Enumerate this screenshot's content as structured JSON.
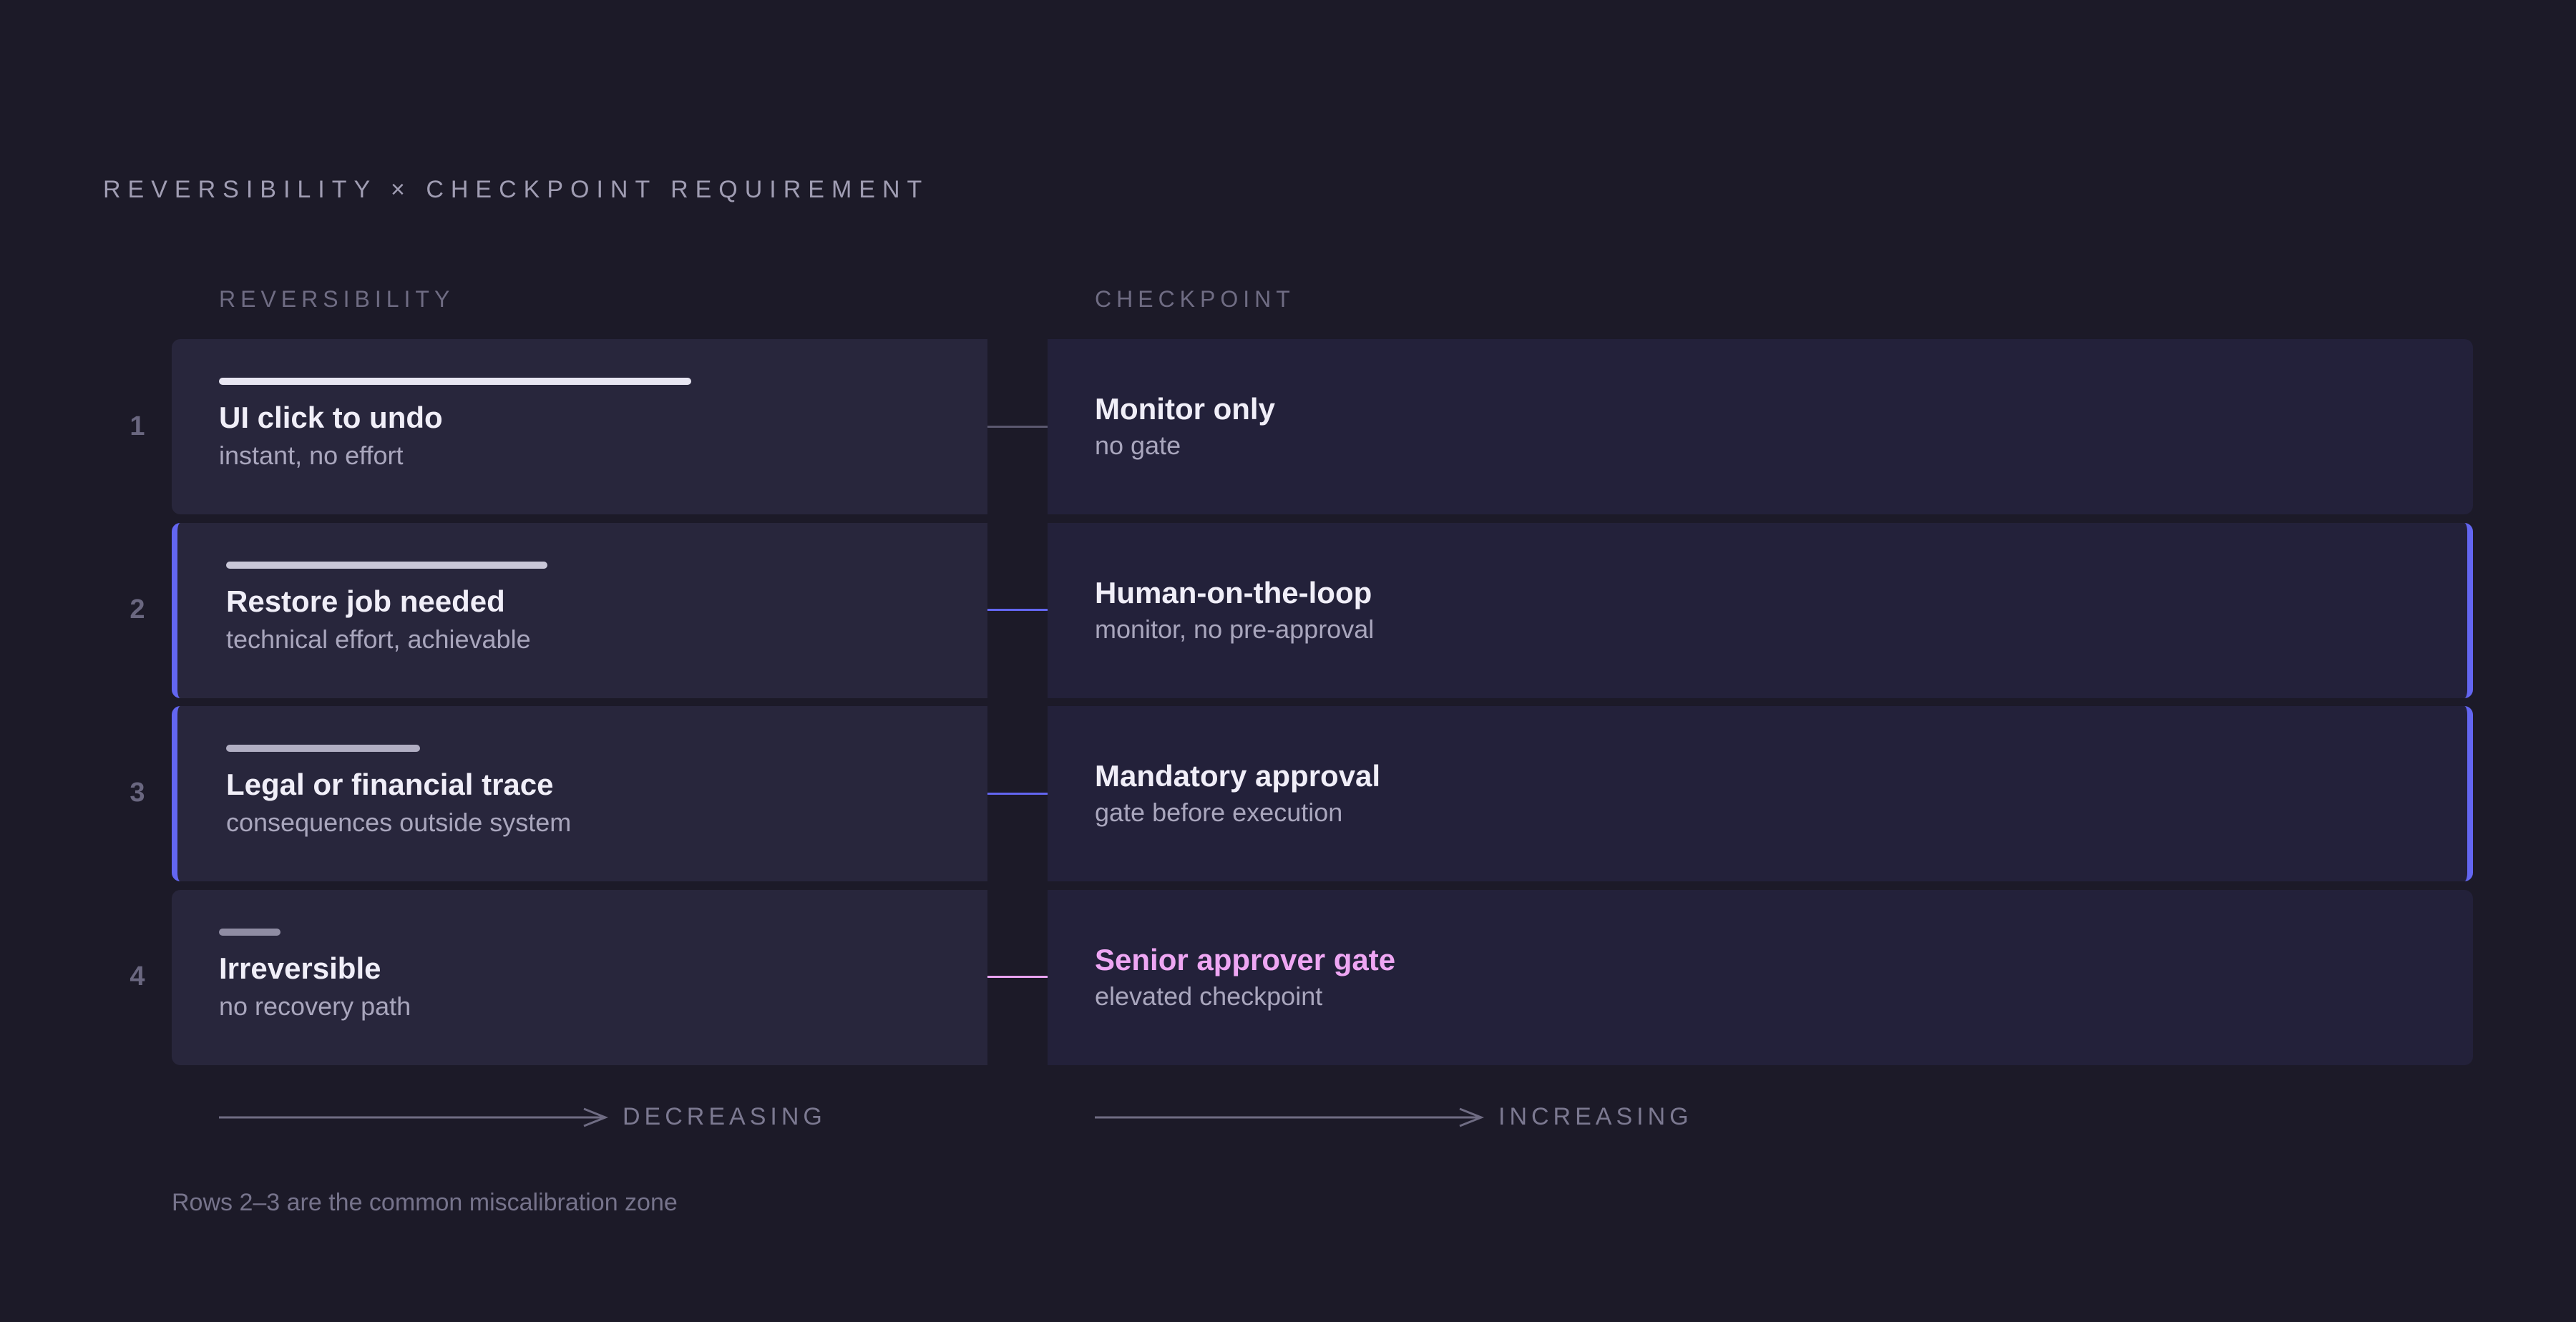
{
  "title": "REVERSIBILITY × CHECKPOINT REQUIREMENT",
  "columns": {
    "left": "REVERSIBILITY",
    "right": "CHECKPOINT"
  },
  "rows": [
    {
      "num": "1",
      "rev_title": "UI click to undo",
      "rev_sub": "instant, no effort",
      "rev_level": 1.0,
      "chk_title": "Monitor only",
      "chk_sub": "no gate",
      "highlight": false,
      "connector_color": "#5b586f",
      "bar_color": "#e8e6f2",
      "chk_title_color": "#f0eef8"
    },
    {
      "num": "2",
      "rev_title": "Restore job needed",
      "rev_sub": "technical effort, achievable",
      "rev_level": 0.68,
      "chk_title": "Human-on-the-loop",
      "chk_sub": "monitor, no pre-approval",
      "highlight": true,
      "connector_color": "#6366f1",
      "bar_color": "#c9c7d8",
      "chk_title_color": "#f0eef8"
    },
    {
      "num": "3",
      "rev_title": "Legal or financial trace",
      "rev_sub": "consequences outside system",
      "rev_level": 0.41,
      "chk_title": "Mandatory approval",
      "chk_sub": "gate before execution",
      "highlight": true,
      "connector_color": "#6366f1",
      "bar_color": "#b1aec3",
      "chk_title_color": "#f0eef8"
    },
    {
      "num": "4",
      "rev_title": "Irreversible",
      "rev_sub": "no recovery path",
      "rev_level": 0.13,
      "chk_title": "Senior approver gate",
      "chk_sub": "elevated checkpoint",
      "highlight": false,
      "connector_color": "#e8a2f0",
      "bar_color": "#8f8ca3",
      "chk_title_color": "#eea6f3"
    }
  ],
  "axis": {
    "left": "DECREASING",
    "right": "INCREASING"
  },
  "footnote": "Rows 2–3 are the common miscalibration zone"
}
